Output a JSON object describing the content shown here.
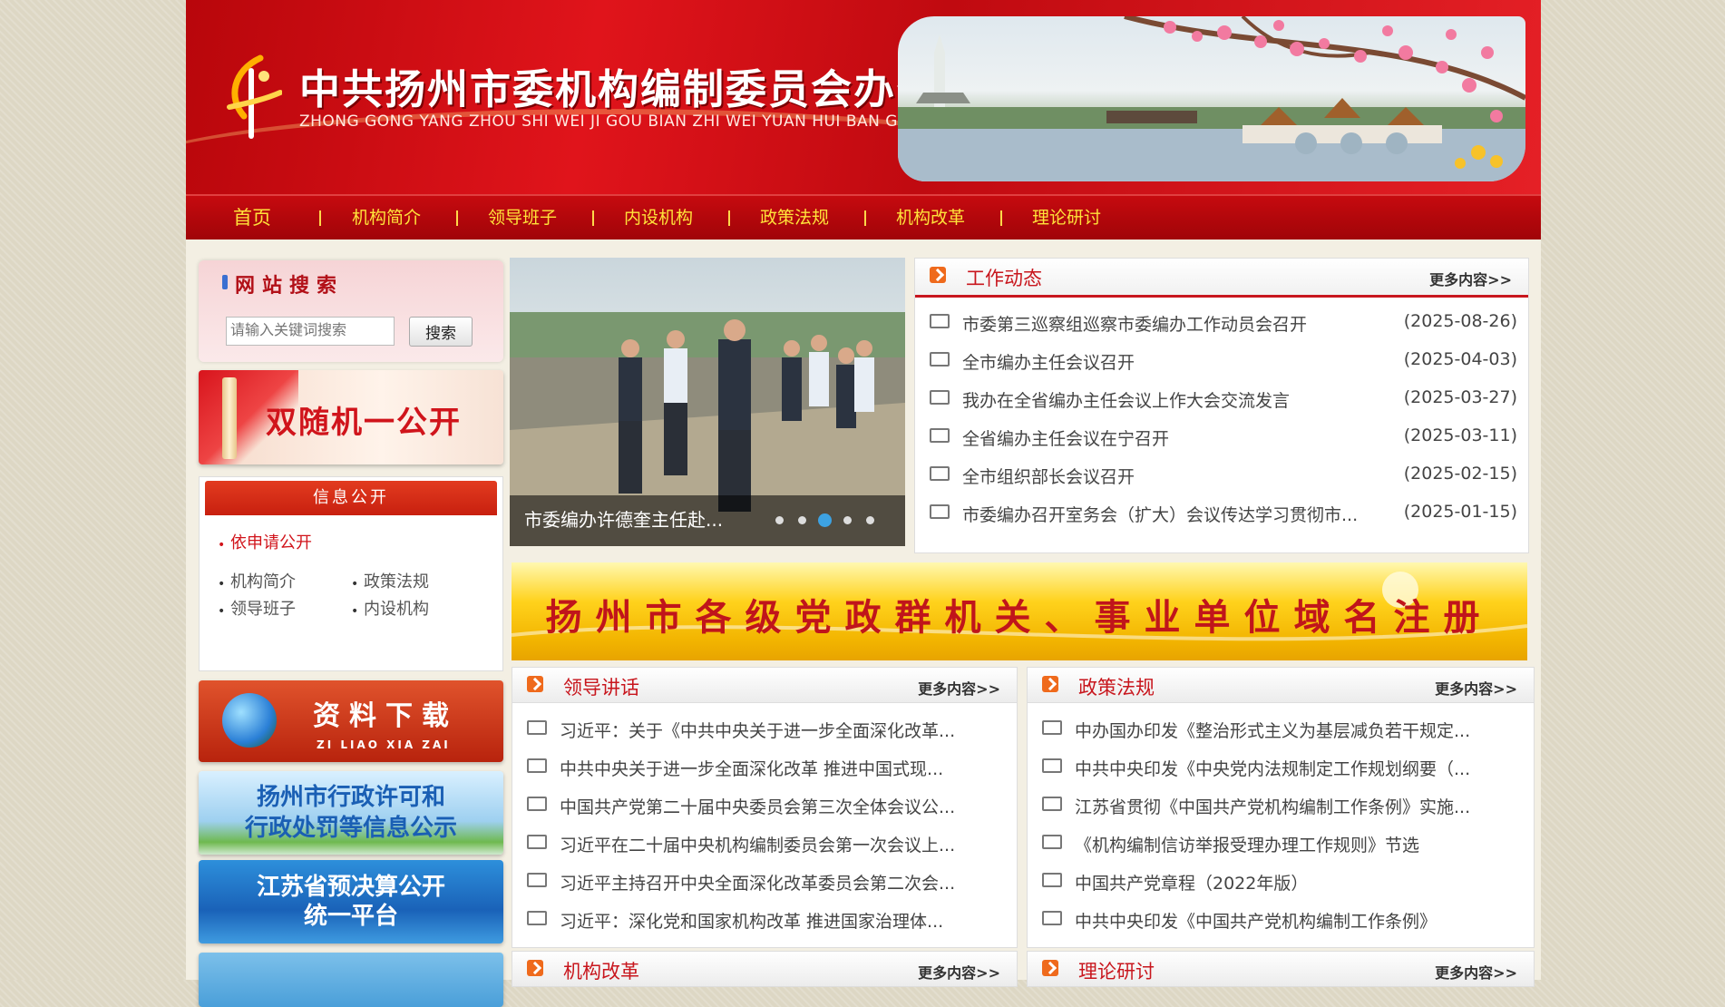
{
  "header": {
    "site_title": "中共扬州市委机构编制委员会办公室",
    "site_pinyin": "ZHONG GONG YANG ZHOU SHI WEI JI GOU BIAN ZHI WEI YUAN HUI BAN GONG SHI"
  },
  "nav": [
    "首页",
    "机构简介",
    "领导班子",
    "内设机构",
    "政策法规",
    "机构改革",
    "理论研讨"
  ],
  "search": {
    "title": "网站搜索",
    "placeholder": "请输入关键词搜索",
    "button": "搜索"
  },
  "promos": {
    "random": "双随机一公开",
    "download_cn": "资料下载",
    "download_pinyin": "ZI LIAO XIA ZAI",
    "permit_line1": "扬州市行政许可和",
    "permit_line2": "行政处罚等信息公示",
    "budget_line1": "江苏省预决算公开",
    "budget_line2": "统一平台"
  },
  "info_open": {
    "title": "信息公开",
    "apply": "依申请公开",
    "links": [
      "机构简介",
      "政策法规",
      "领导班子",
      "内设机构"
    ]
  },
  "slideshow": {
    "caption": "市委编办许德奎主任赴...",
    "dot_count": 5,
    "active_dot": 2
  },
  "work_news": {
    "title": "工作动态",
    "more": "更多内容>>",
    "items": [
      {
        "title": "市委第三巡察组巡察市委编办工作动员会召开",
        "date": "(2025-08-26)"
      },
      {
        "title": "全市编办主任会议召开",
        "date": "(2025-04-03)"
      },
      {
        "title": "我办在全省编办主任会议上作大会交流发言",
        "date": "(2025-03-27)"
      },
      {
        "title": "全省编办主任会议在宁召开",
        "date": "(2025-03-11)"
      },
      {
        "title": "全市组织部长会议召开",
        "date": "(2025-02-15)"
      },
      {
        "title": "市委编办召开室务会（扩大）会议传达学习贯彻市...",
        "date": "(2025-01-15)"
      }
    ]
  },
  "domain_banner": "扬州市各级党政群机关、事业单位域名注册",
  "leader_speech": {
    "title": "领导讲话",
    "more": "更多内容>>",
    "items": [
      "习近平：关于《中共中央关于进一步全面深化改革...",
      "中共中央关于进一步全面深化改革 推进中国式现...",
      "中国共产党第二十届中央委员会第三次全体会议公...",
      "习近平在二十届中央机构编制委员会第一次会议上...",
      "习近平主持召开中央全面深化改革委员会第二次会...",
      "习近平：深化党和国家机构改革 推进国家治理体..."
    ]
  },
  "policy": {
    "title": "政策法规",
    "more": "更多内容>>",
    "items": [
      "中办国办印发《整治形式主义为基层减负若干规定...",
      "中共中央印发《中央党内法规制定工作规划纲要（...",
      "江苏省贯彻《中国共产党机构编制工作条例》实施...",
      "《机构编制信访举报受理办理工作规则》节选",
      "中国共产党章程（2022年版）",
      "中共中央印发《中国共产党机构编制工作条例》"
    ]
  },
  "reform": {
    "title": "机构改革",
    "more": "更多内容>>"
  },
  "theory": {
    "title": "理论研讨",
    "more": "更多内容>>"
  },
  "colors": {
    "brand_red": "#c8161d",
    "nav_text": "#ffe33a",
    "icon_orange": "#ef6a1c"
  }
}
